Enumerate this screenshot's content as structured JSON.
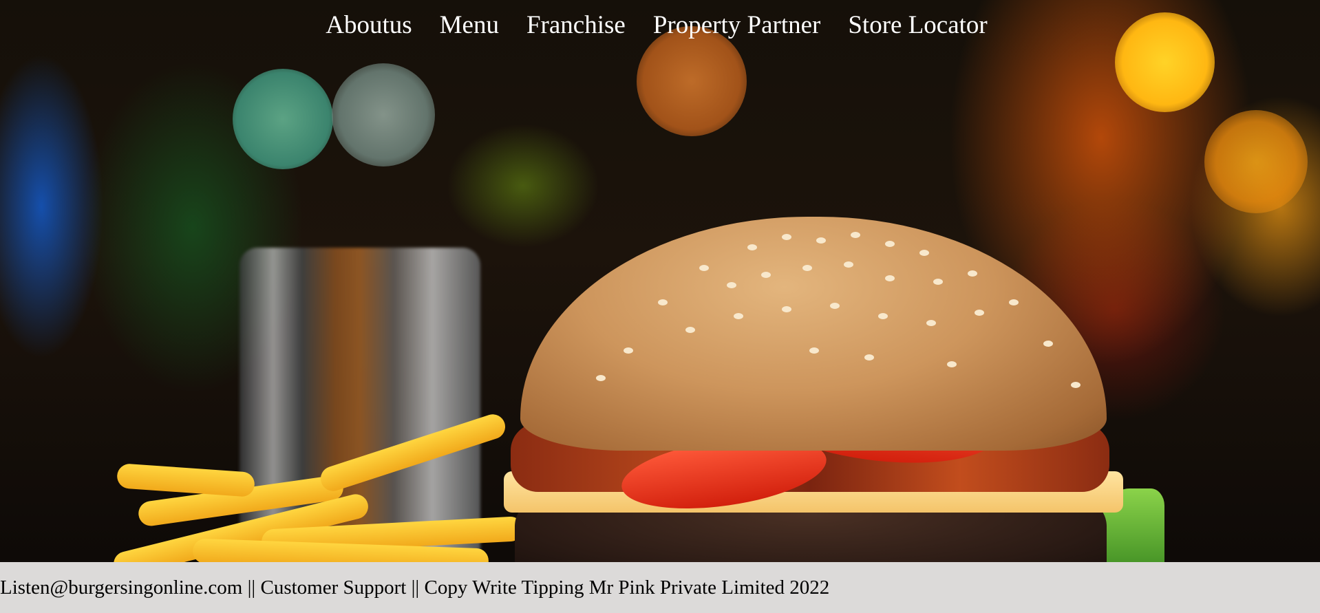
{
  "nav": {
    "items": [
      {
        "label": "Aboutus"
      },
      {
        "label": "Menu"
      },
      {
        "label": "Franchise"
      },
      {
        "label": "Property Partner"
      },
      {
        "label": "Store Locator"
      }
    ]
  },
  "hero": {
    "image": "burger-with-fries-photo"
  },
  "footer": {
    "email": "Listen@burgersingonline.com",
    "sep1": " || ",
    "support": "Customer Support",
    "sep2": " || ",
    "copyright": "Copy Write Tipping Mr Pink Private Limited 2022"
  },
  "colors": {
    "nav_text": "#ffffff",
    "footer_bg": "#dcdad9",
    "footer_text": "#000000"
  }
}
